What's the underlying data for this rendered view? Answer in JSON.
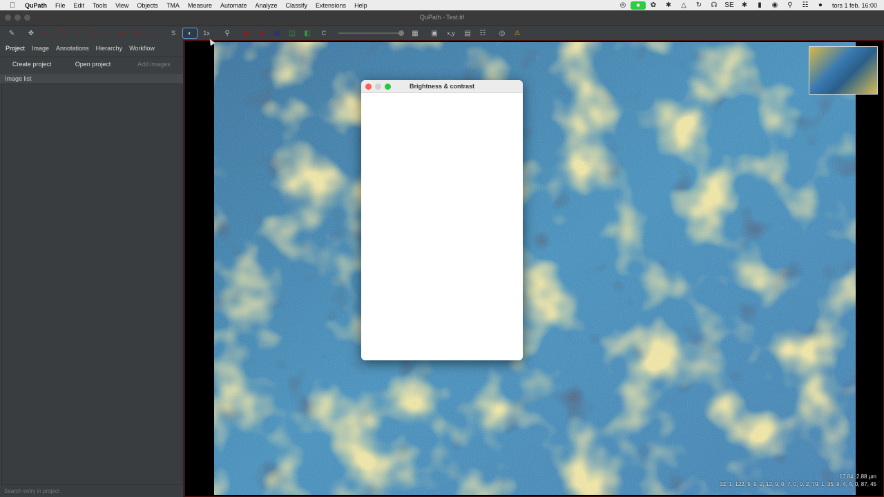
{
  "menubar": {
    "app_name": "QuPath",
    "menus": [
      "File",
      "Edit",
      "Tools",
      "View",
      "Objects",
      "TMA",
      "Measure",
      "Automate",
      "Analyze",
      "Classify",
      "Extensions",
      "Help"
    ],
    "clock": "tors 1 feb. 16:00",
    "input_source": "SE"
  },
  "window": {
    "title": "QuPath - Test.tif"
  },
  "toolbar": {
    "s_label": "S",
    "zoom_label": "1x",
    "c_label": "C",
    "xy_label": "x,y"
  },
  "left_panel": {
    "tabs": [
      "Project",
      "Image",
      "Annotations",
      "Hierarchy",
      "Workflow"
    ],
    "create_project": "Create project",
    "open_project": "Open project",
    "add_images": "Add images",
    "image_list_header": "Image list",
    "search_placeholder": "Search entry in project"
  },
  "viewer": {
    "coords_line1": "17.84, 2.88 µm",
    "coords_line2": "32, 1, 122, 9, 9, 2, 12, 9, 0, 7, 0, 0, 2, 79, 1, 35, 9, 4, 4, 0, 87, 45"
  },
  "dialog": {
    "title": "Brightness & contrast"
  },
  "colors": {
    "dialog_close": "#ff5f57",
    "dialog_minimize": "#d0d0d0",
    "dialog_zoom": "#28c840"
  }
}
